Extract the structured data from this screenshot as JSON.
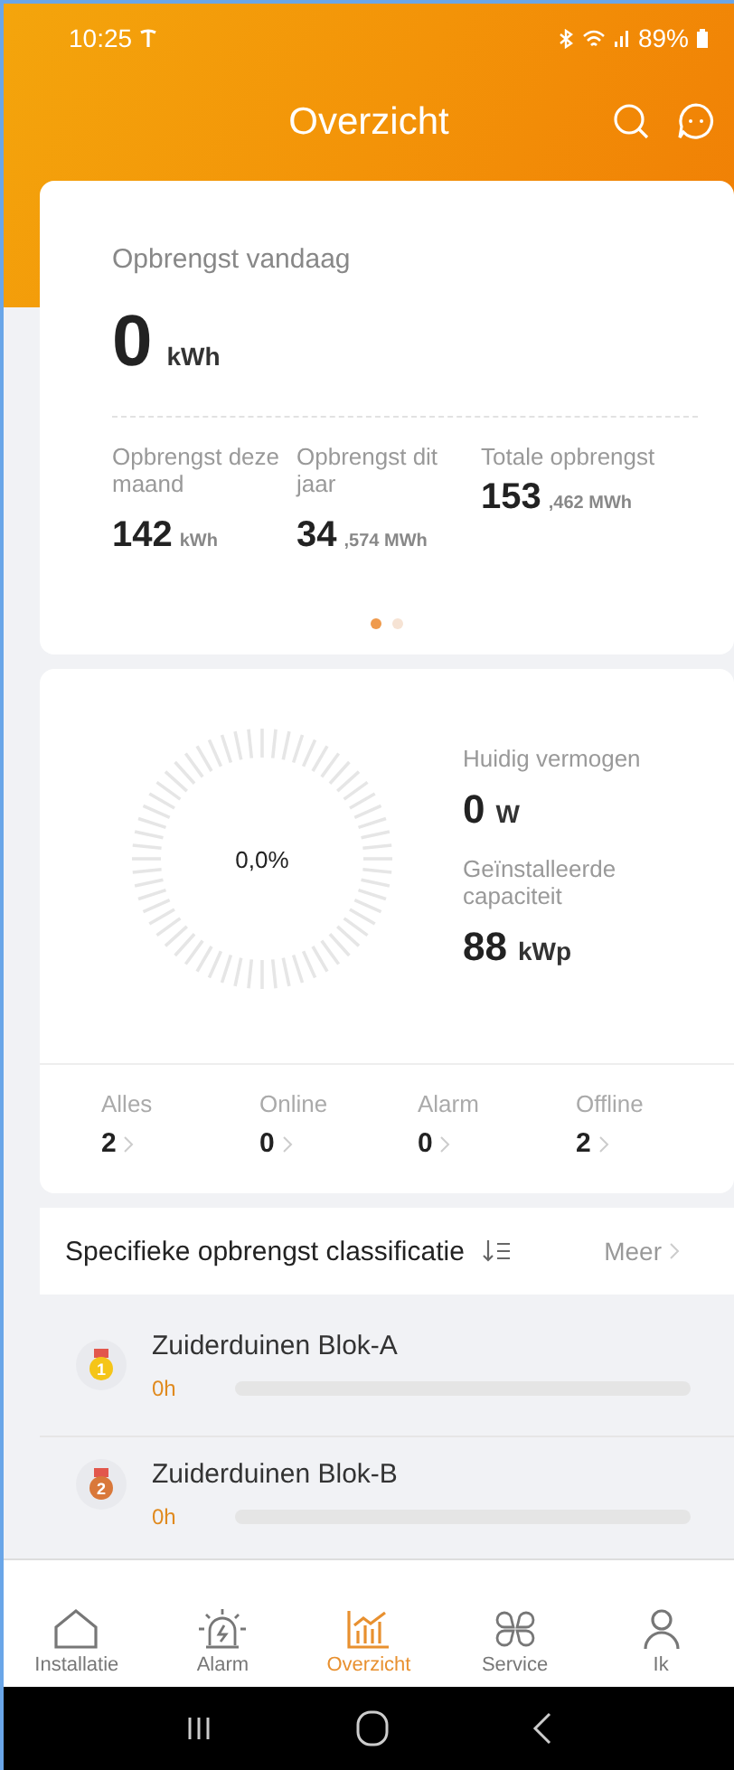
{
  "status_bar": {
    "time": "10:25",
    "battery": "89%"
  },
  "header": {
    "title": "Overzicht"
  },
  "yield_card": {
    "today_label": "Opbrengst vandaag",
    "today_value": "0",
    "today_unit": "kWh",
    "stats": [
      {
        "label": "Opbrengst deze maand",
        "value": "142",
        "unit": "kWh"
      },
      {
        "label": "Opbrengst dit jaar",
        "value": "34",
        "unit": ",574 MWh"
      },
      {
        "label": "Totale opbrengst",
        "value": "153",
        "unit": ",462 MWh"
      }
    ],
    "pages": [
      {
        "selected": true
      },
      {
        "selected": false
      }
    ]
  },
  "power_card": {
    "gauge": {
      "reading": "0,0%"
    },
    "current_label": "Huidig vermogen",
    "current_value": "0",
    "current_unit": "W",
    "capacity_label": "Geïnstalleerde capaciteit",
    "capacity_value": "88",
    "capacity_unit": "kWp",
    "counts": [
      {
        "label": "Alles",
        "value": "2"
      },
      {
        "label": "Online",
        "value": "0"
      },
      {
        "label": "Alarm",
        "value": "0"
      },
      {
        "label": "Offline",
        "value": "2"
      }
    ]
  },
  "ranking": {
    "title": "Specifieke opbrengst classificatie",
    "more": "Meer",
    "rows": [
      {
        "rank": "1",
        "kind": "gold",
        "name": "Zuiderduinen Blok-A",
        "value": "0h"
      },
      {
        "rank": "2",
        "kind": "bronze",
        "name": "Zuiderduinen Blok-B",
        "value": "0h"
      }
    ]
  },
  "tabs": [
    {
      "label": "Installatie",
      "selected": false
    },
    {
      "label": "Alarm",
      "selected": false
    },
    {
      "label": "Overzicht",
      "selected": true
    },
    {
      "label": "Service",
      "selected": false
    },
    {
      "label": "Ik",
      "selected": false
    }
  ]
}
